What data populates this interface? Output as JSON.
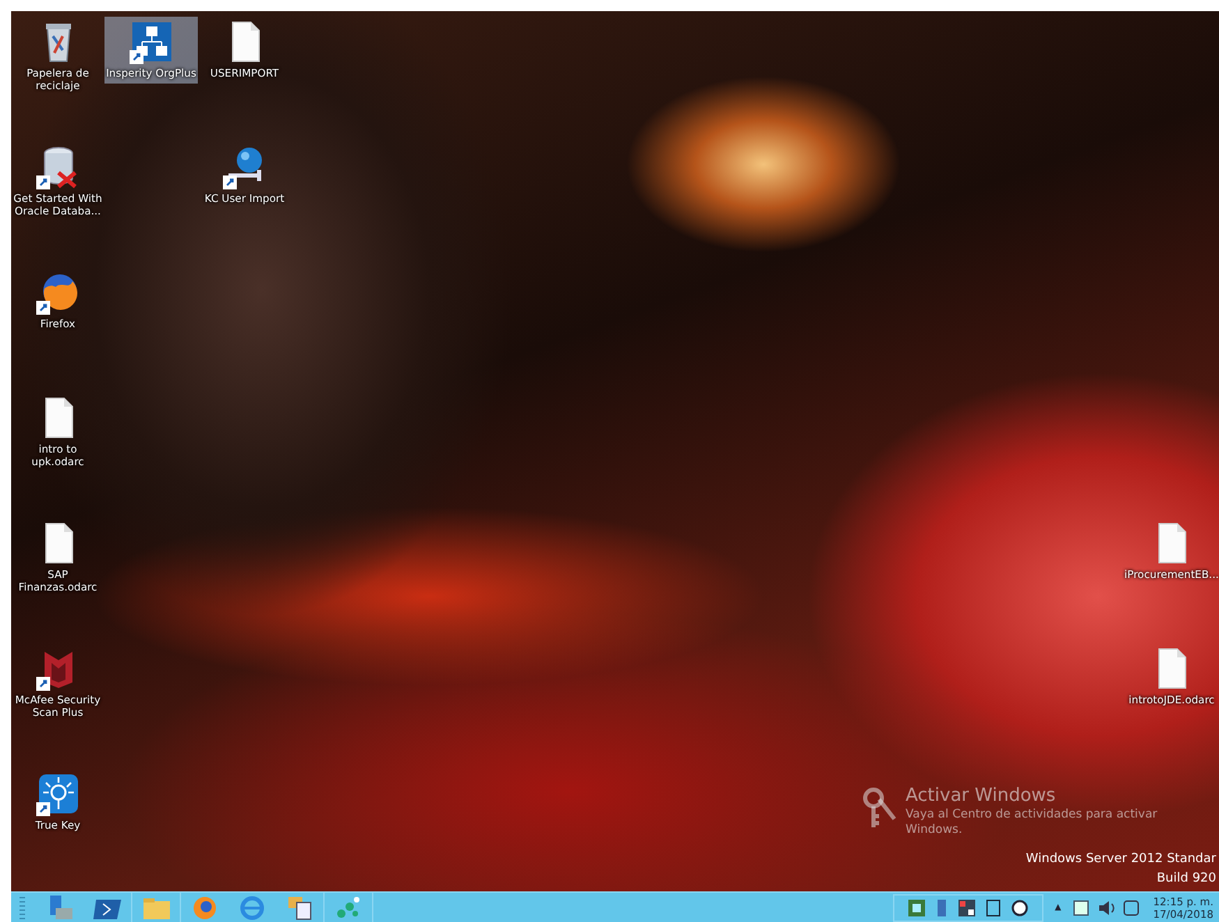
{
  "desktop": {
    "icon_columns": [
      [
        {
          "label": "Papelera de reciclaje",
          "kind": "recycle-bin",
          "shortcut": false,
          "selected": false
        },
        {
          "label": "Get Started With Oracle Databa...",
          "kind": "database",
          "shortcut": true,
          "selected": false
        },
        {
          "label": "Firefox",
          "kind": "firefox",
          "shortcut": true,
          "selected": false
        },
        {
          "label": "intro to upk.odarc",
          "kind": "document",
          "shortcut": false,
          "selected": false
        },
        {
          "label": "SAP Finanzas.odarc",
          "kind": "document",
          "shortcut": false,
          "selected": false
        },
        {
          "label": "McAfee Security Scan Plus",
          "kind": "mcafee",
          "shortcut": true,
          "selected": false
        },
        {
          "label": "True Key",
          "kind": "truekey",
          "shortcut": true,
          "selected": false
        }
      ],
      [
        {
          "label": "Insperity OrgPlus",
          "kind": "orgchart",
          "shortcut": true,
          "selected": true
        }
      ],
      [
        {
          "label": "USERIMPORT",
          "kind": "document",
          "shortcut": false,
          "selected": false
        },
        {
          "label": "KC User Import",
          "kind": "globe",
          "shortcut": true,
          "selected": false
        }
      ]
    ],
    "right_icons": [
      {
        "label": "iProcurementEB...",
        "kind": "document",
        "shortcut": false,
        "selected": false
      },
      {
        "label": "introtoJDE.odarc",
        "kind": "document",
        "shortcut": false,
        "selected": false
      }
    ]
  },
  "activation_notice": {
    "title": "Activar Windows",
    "text": "Vaya al Centro de actividades para activar Windows."
  },
  "edition": {
    "name": "Windows Server 2012 Standar",
    "build": "Build 920"
  },
  "taskbar": {
    "clock": {
      "time": "12:15 p. m.",
      "date": "17/04/2018"
    },
    "tray_expander": "▲"
  }
}
